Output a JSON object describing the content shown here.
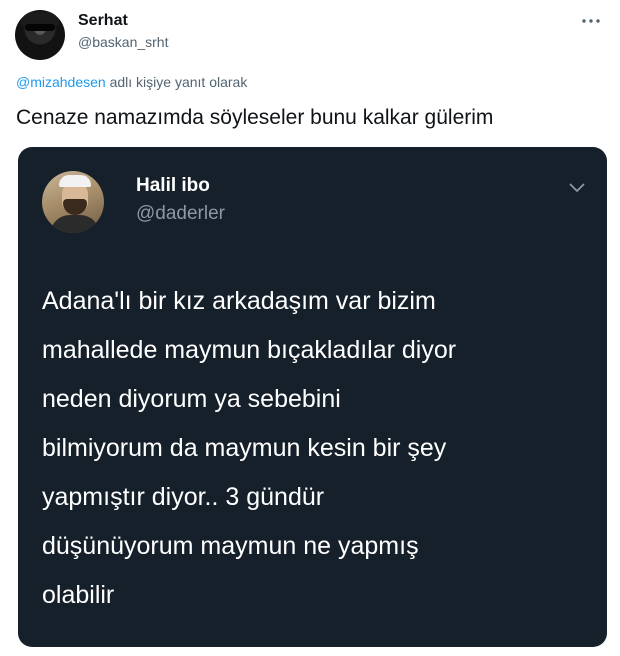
{
  "outer_tweet": {
    "author_name": "Serhat",
    "author_handle": "@baskan_srht",
    "reply_mention": "@mizahdesen",
    "reply_suffix": " adlı kişiye yanıt olarak",
    "text": "Cenaze namazımda söyleseler bunu kalkar gülerim",
    "more_icon": "more-dots-icon"
  },
  "embedded_tweet": {
    "author_name": "Halil ibo",
    "author_handle": "@daderler",
    "chevron_icon": "chevron-down-icon",
    "text_lines": [
      "Adana'lı bir kız arkadaşım var bizim",
      "mahallede maymun bıçakladılar diyor",
      "neden diyorum ya sebebini",
      "bilmiyorum da maymun kesin bir şey",
      "yapmıştır diyor.. 3 gündür",
      "düşünüyorum maymun ne yapmış",
      "olabilir"
    ]
  },
  "colors": {
    "background": "#ffffff",
    "text_primary": "#0f1419",
    "text_secondary": "#536471",
    "link": "#1d9bf0",
    "dark_card": "#15202b",
    "dark_secondary": "#8b98a5"
  }
}
